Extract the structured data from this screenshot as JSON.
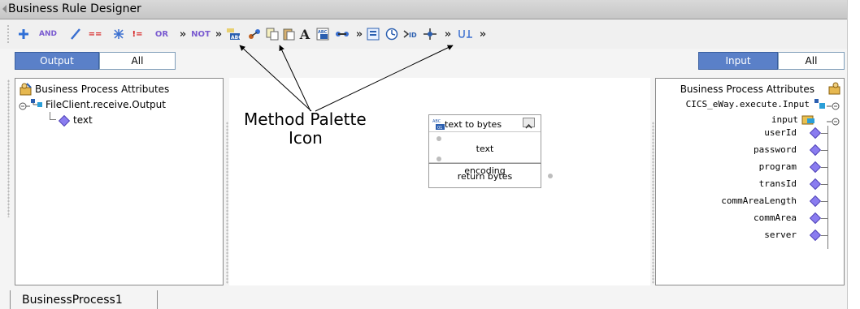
{
  "window": {
    "title": "Business Rule Designer"
  },
  "toolbar": {
    "items": [
      {
        "name": "add-icon"
      },
      {
        "name": "and-icon",
        "label": "AND"
      },
      {
        "name": "divide-icon"
      },
      {
        "name": "equals-icon",
        "label": "=="
      },
      {
        "name": "multiply-icon"
      },
      {
        "name": "not-equal-icon",
        "label": "!="
      },
      {
        "name": "or-icon",
        "label": "OR"
      },
      {
        "name": "more-chevron-1",
        "label": "»"
      },
      {
        "name": "not-icon",
        "label": "NOT"
      },
      {
        "name": "more-chevron-2",
        "label": "»"
      },
      {
        "name": "string-method-icon"
      },
      {
        "name": "link-icon"
      },
      {
        "name": "copy-icon"
      },
      {
        "name": "paste-icon"
      },
      {
        "name": "font-a-icon",
        "label": "A"
      },
      {
        "name": "abc-01-method-icon"
      },
      {
        "name": "operators-icon"
      },
      {
        "name": "more-chevron-3",
        "label": "»"
      },
      {
        "name": "id-icon"
      },
      {
        "name": "timer-icon"
      },
      {
        "name": "id-arrow-icon"
      },
      {
        "name": "network-icon"
      },
      {
        "name": "more-chevron-4",
        "label": "»"
      },
      {
        "name": "underline-icon"
      },
      {
        "name": "more-chevron-5",
        "label": "»"
      }
    ]
  },
  "left": {
    "tabs": {
      "output": "Output",
      "all": "All"
    },
    "tree": {
      "root": "Business Process Attributes",
      "node": "FileClient.receive.Output",
      "leaf": "text"
    }
  },
  "right": {
    "tabs": {
      "input": "Input",
      "all": "All"
    },
    "tree": {
      "root": "Business Process Attributes",
      "node": "CICS_eWay.execute.Input",
      "sub": "input",
      "fields": [
        "userId",
        "password",
        "program",
        "transId",
        "commAreaLength",
        "commArea",
        "server"
      ]
    }
  },
  "method_block": {
    "title": "text to bytes",
    "inputs": [
      "text",
      "encoding"
    ],
    "output": "return bytes"
  },
  "annotation": {
    "line1": "Method Palette",
    "line2": "Icon"
  },
  "bottom_tabs": [
    "BusinessProcess1"
  ],
  "colors": {
    "selected_tab": "#5a80c8",
    "diamond": "#8a7cf0"
  }
}
